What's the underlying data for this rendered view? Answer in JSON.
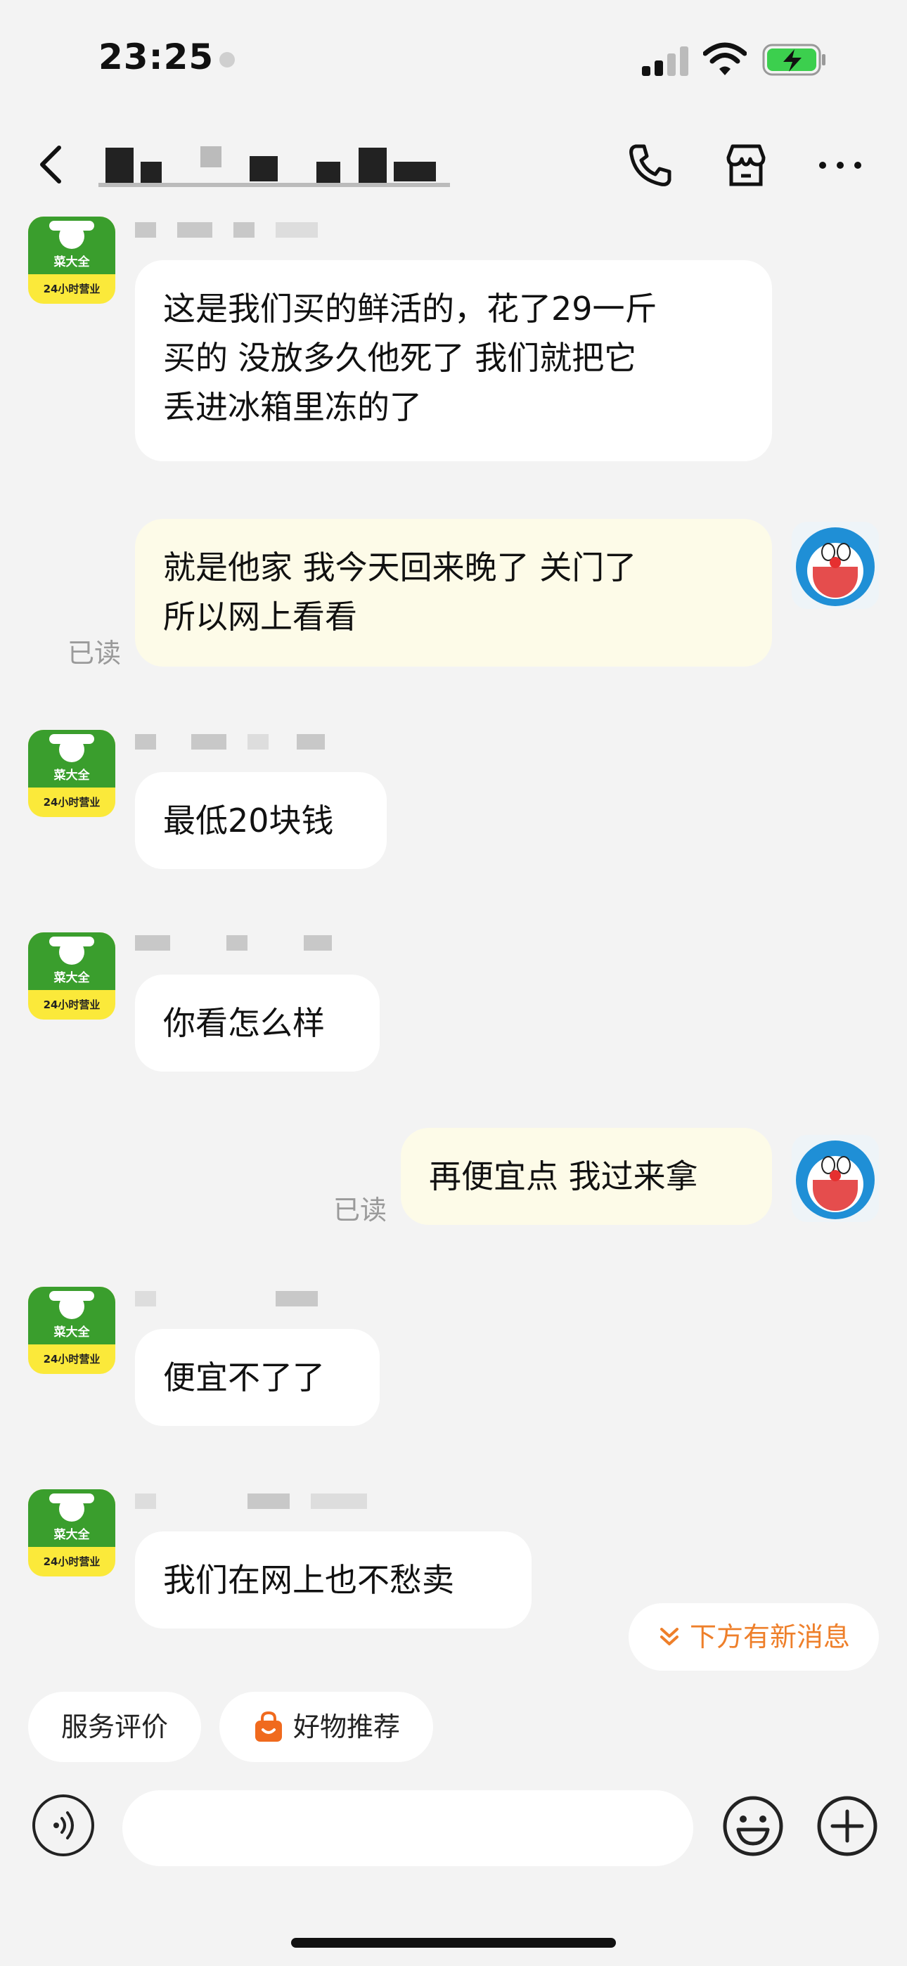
{
  "status_bar": {
    "time": "23:25"
  },
  "header": {
    "back_icon": "chevron-left-icon",
    "title": "",
    "actions": [
      "phone-icon",
      "store-icon",
      "more-icon"
    ]
  },
  "shop_avatar": {
    "name_line": "菜大全",
    "sub_line": "24小时营业"
  },
  "messages": [
    {
      "from": "shop",
      "text": "这是我们买的鲜活的，花了29一斤\n买的  没放多久他死了 我们就把它\n丢进冰箱里冻的了"
    },
    {
      "from": "me",
      "text": "就是他家 我今天回来晚了 关门了\n所以网上看看",
      "status": "已读"
    },
    {
      "from": "shop",
      "text": "最低20块钱"
    },
    {
      "from": "shop",
      "text": "你看怎么样"
    },
    {
      "from": "me",
      "text": "再便宜点 我过来拿",
      "status": "已读"
    },
    {
      "from": "shop",
      "text": "便宜不了了"
    },
    {
      "from": "shop",
      "text": "我们在网上也不愁卖"
    }
  ],
  "new_message_pill": {
    "label": "下方有新消息",
    "icon": "double-chevron-down-icon"
  },
  "quick_actions": [
    {
      "label": "服务评价"
    },
    {
      "label": "好物推荐",
      "icon": "shopping-bag-icon"
    }
  ],
  "composer": {
    "input_value": "",
    "voice_icon": "voice-icon",
    "emoji_icon": "emoji-icon",
    "plus_icon": "plus-icon"
  },
  "colors": {
    "background": "#f3f3f3",
    "incoming_bubble": "#ffffff",
    "outgoing_bubble": "#fdfbe8",
    "accent": "#ee7f2a",
    "shop_green": "#3a9e2d",
    "shop_yellow": "#fbe93a",
    "battery_green": "#3ccf4e"
  }
}
